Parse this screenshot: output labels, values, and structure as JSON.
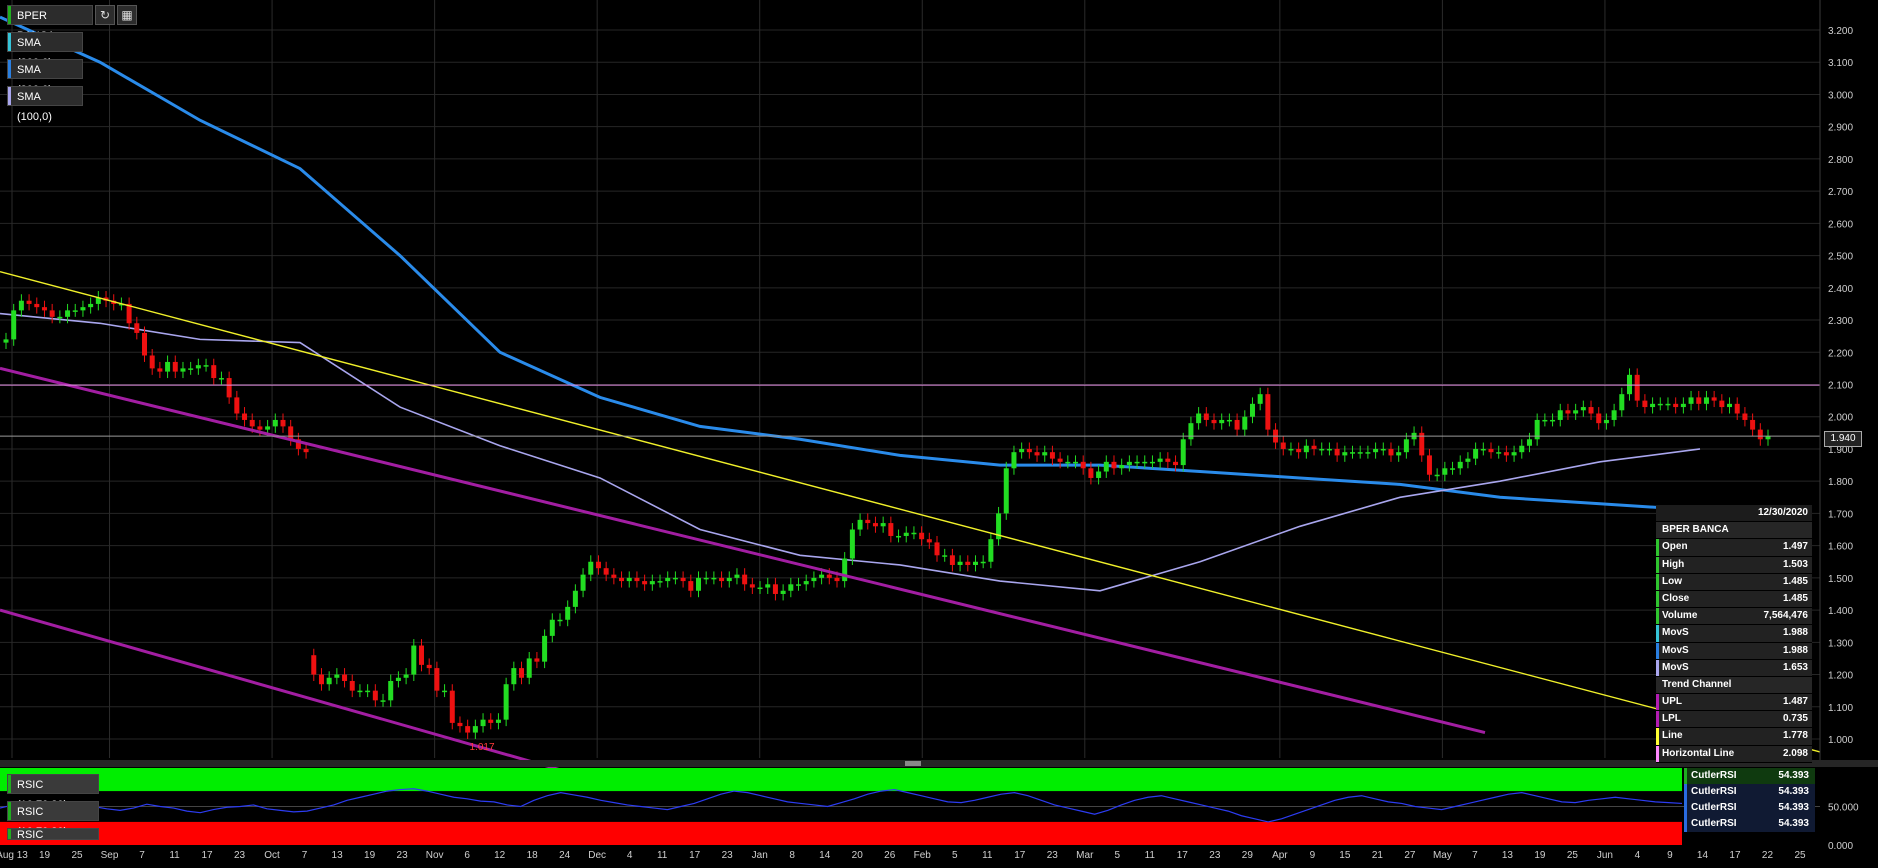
{
  "instrument": "BPER BANCA",
  "toolbar": {
    "refresh_icon": "refresh-icon",
    "calendar_icon": "calendar-icon"
  },
  "indicators": [
    {
      "label": "SMA (200,0)",
      "color": "#35c4d8"
    },
    {
      "label": "SMA (200,0)",
      "color": "#2a7fe0"
    },
    {
      "label": "SMA (100,0)",
      "color": "#a9a6ee"
    }
  ],
  "last_price": "1.940",
  "chart_data": {
    "type": "candlestick",
    "title": "BPER BANCA",
    "ylim": [
      0.9,
      3.25
    ],
    "yticks": [
      "1.000",
      "1.100",
      "1.200",
      "1.300",
      "1.400",
      "1.500",
      "1.600",
      "1.700",
      "1.800",
      "1.900",
      "2.000",
      "2.100",
      "2.200",
      "2.300",
      "2.400",
      "2.500",
      "2.600",
      "2.700",
      "2.800",
      "2.900",
      "3.000",
      "3.100",
      "3.200"
    ],
    "x_tick_labels": [
      "Aug 13",
      "19",
      "25",
      "Sep",
      "7",
      "11",
      "17",
      "23",
      "Oct",
      "7",
      "13",
      "19",
      "23",
      "Nov",
      "6",
      "12",
      "18",
      "24",
      "Dec",
      "4",
      "11",
      "17",
      "23",
      "Jan",
      "8",
      "14",
      "20",
      "26",
      "Feb",
      "5",
      "11",
      "17",
      "23",
      "Mar",
      "5",
      "11",
      "17",
      "23",
      "29",
      "Apr",
      "9",
      "15",
      "21",
      "27",
      "May",
      "7",
      "13",
      "19",
      "25",
      "Jun",
      "4",
      "9",
      "14",
      "17",
      "22",
      "25"
    ],
    "close": [
      2.24,
      2.33,
      2.36,
      2.35,
      2.34,
      2.33,
      2.31,
      2.31,
      2.33,
      2.33,
      2.34,
      2.35,
      2.37,
      2.36,
      2.35,
      2.35,
      2.29,
      2.26,
      2.19,
      2.15,
      2.14,
      2.17,
      2.14,
      2.15,
      2.15,
      2.16,
      2.16,
      2.12,
      2.12,
      2.06,
      2.01,
      1.99,
      1.97,
      1.96,
      1.97,
      1.99,
      1.97,
      1.93,
      1.9,
      1.89,
      1.2,
      1.17,
      1.19,
      1.2,
      1.18,
      1.15,
      1.15,
      1.15,
      1.12,
      1.12,
      1.18,
      1.19,
      1.2,
      1.29,
      1.23,
      1.22,
      1.15,
      1.15,
      1.05,
      1.04,
      1.02,
      1.04,
      1.06,
      1.05,
      1.06,
      1.17,
      1.22,
      1.19,
      1.25,
      1.24,
      1.32,
      1.37,
      1.37,
      1.41,
      1.46,
      1.51,
      1.55,
      1.53,
      1.51,
      1.5,
      1.49,
      1.5,
      1.49,
      1.48,
      1.49,
      1.49,
      1.5,
      1.5,
      1.49,
      1.46,
      1.5,
      1.5,
      1.5,
      1.49,
      1.5,
      1.51,
      1.48,
      1.47,
      1.47,
      1.48,
      1.45,
      1.46,
      1.48,
      1.48,
      1.49,
      1.5,
      1.51,
      1.5,
      1.49,
      1.56,
      1.65,
      1.68,
      1.67,
      1.66,
      1.67,
      1.63,
      1.63,
      1.64,
      1.64,
      1.62,
      1.61,
      1.57,
      1.57,
      1.54,
      1.55,
      1.54,
      1.55,
      1.55,
      1.62,
      1.7,
      1.84,
      1.89,
      1.9,
      1.89,
      1.88,
      1.89,
      1.87,
      1.86,
      1.86,
      1.86,
      1.84,
      1.81,
      1.83,
      1.86,
      1.84,
      1.85,
      1.86,
      1.86,
      1.86,
      1.86,
      1.87,
      1.86,
      1.85,
      1.93,
      1.98,
      2.01,
      1.99,
      1.98,
      1.99,
      1.99,
      1.96,
      2.0,
      2.04,
      2.07,
      1.96,
      1.92,
      1.9,
      1.9,
      1.89,
      1.91,
      1.9,
      1.9,
      1.9,
      1.88,
      1.89,
      1.89,
      1.89,
      1.89,
      1.9,
      1.9,
      1.88,
      1.89,
      1.93,
      1.95,
      1.88,
      1.82,
      1.82,
      1.84,
      1.84,
      1.86,
      1.87,
      1.9,
      1.9,
      1.89,
      1.89,
      1.88,
      1.89,
      1.91,
      1.93,
      1.99,
      1.99,
      1.99,
      2.02,
      2.01,
      2.02,
      2.03,
      2.01,
      1.98,
      1.99,
      2.02,
      2.07,
      2.13,
      2.05,
      2.03,
      2.04,
      2.04,
      2.04,
      2.03,
      2.04,
      2.06,
      2.04,
      2.06,
      2.05,
      2.03,
      2.04,
      2.01,
      1.99,
      1.96,
      1.93,
      1.94
    ],
    "open": [
      2.23,
      2.24,
      2.33,
      2.36,
      2.35,
      2.34,
      2.33,
      2.31,
      2.31,
      2.33,
      2.33,
      2.34,
      2.35,
      2.37,
      2.36,
      2.35,
      2.35,
      2.29,
      2.26,
      2.19,
      2.15,
      2.14,
      2.17,
      2.14,
      2.15,
      2.15,
      2.16,
      2.16,
      2.12,
      2.12,
      2.06,
      2.01,
      1.99,
      1.97,
      1.96,
      1.97,
      1.99,
      1.97,
      1.93,
      1.9,
      1.26,
      1.2,
      1.17,
      1.19,
      1.2,
      1.18,
      1.15,
      1.15,
      1.15,
      1.12,
      1.12,
      1.18,
      1.19,
      1.2,
      1.29,
      1.23,
      1.22,
      1.15,
      1.15,
      1.05,
      1.04,
      1.02,
      1.04,
      1.06,
      1.05,
      1.06,
      1.17,
      1.22,
      1.19,
      1.25,
      1.24,
      1.32,
      1.37,
      1.37,
      1.41,
      1.46,
      1.51,
      1.55,
      1.53,
      1.51,
      1.5,
      1.49,
      1.5,
      1.49,
      1.48,
      1.49,
      1.49,
      1.5,
      1.5,
      1.49,
      1.46,
      1.5,
      1.5,
      1.5,
      1.49,
      1.5,
      1.51,
      1.48,
      1.47,
      1.47,
      1.48,
      1.45,
      1.46,
      1.48,
      1.48,
      1.49,
      1.5,
      1.51,
      1.5,
      1.49,
      1.56,
      1.65,
      1.68,
      1.67,
      1.66,
      1.67,
      1.63,
      1.63,
      1.64,
      1.64,
      1.62,
      1.61,
      1.57,
      1.57,
      1.54,
      1.55,
      1.54,
      1.55,
      1.55,
      1.62,
      1.7,
      1.84,
      1.89,
      1.9,
      1.89,
      1.88,
      1.89,
      1.87,
      1.86,
      1.86,
      1.86,
      1.84,
      1.81,
      1.83,
      1.86,
      1.84,
      1.85,
      1.86,
      1.86,
      1.86,
      1.86,
      1.87,
      1.86,
      1.85,
      1.93,
      1.98,
      2.01,
      1.99,
      1.98,
      1.99,
      1.99,
      1.96,
      2.0,
      2.04,
      2.07,
      1.96,
      1.92,
      1.9,
      1.9,
      1.89,
      1.91,
      1.9,
      1.9,
      1.9,
      1.88,
      1.89,
      1.89,
      1.89,
      1.89,
      1.9,
      1.9,
      1.88,
      1.89,
      1.93,
      1.95,
      1.88,
      1.82,
      1.82,
      1.84,
      1.84,
      1.86,
      1.87,
      1.9,
      1.9,
      1.89,
      1.89,
      1.88,
      1.89,
      1.91,
      1.93,
      1.99,
      1.99,
      1.99,
      2.02,
      2.01,
      2.02,
      2.03,
      2.01,
      1.98,
      1.99,
      2.02,
      2.07,
      2.13,
      2.05,
      2.03,
      2.04,
      2.04,
      2.04,
      2.03,
      2.04,
      2.06,
      2.04,
      2.06,
      2.05,
      2.03,
      2.04,
      2.01,
      1.99,
      1.96,
      1.93
    ],
    "low_label": "1.017",
    "sma_long": [
      [
        0,
        3.24
      ],
      [
        100,
        3.1
      ],
      [
        200,
        2.92
      ],
      [
        300,
        2.77
      ],
      [
        400,
        2.5
      ],
      [
        500,
        2.2
      ],
      [
        600,
        2.06
      ],
      [
        700,
        1.97
      ],
      [
        800,
        1.93
      ],
      [
        900,
        1.88
      ],
      [
        1000,
        1.85
      ],
      [
        1100,
        1.85
      ],
      [
        1200,
        1.83
      ],
      [
        1300,
        1.81
      ],
      [
        1400,
        1.79
      ],
      [
        1500,
        1.75
      ],
      [
        1600,
        1.73
      ],
      [
        1700,
        1.71
      ]
    ],
    "sma_100": [
      [
        0,
        2.32
      ],
      [
        100,
        2.29
      ],
      [
        200,
        2.24
      ],
      [
        300,
        2.23
      ],
      [
        400,
        2.03
      ],
      [
        500,
        1.91
      ],
      [
        600,
        1.81
      ],
      [
        700,
        1.65
      ],
      [
        800,
        1.57
      ],
      [
        900,
        1.54
      ],
      [
        1000,
        1.49
      ],
      [
        1100,
        1.46
      ],
      [
        1200,
        1.55
      ],
      [
        1300,
        1.66
      ],
      [
        1400,
        1.75
      ],
      [
        1500,
        1.8
      ],
      [
        1600,
        1.86
      ],
      [
        1700,
        1.9
      ]
    ],
    "trend_line": {
      "start": 2.45,
      "end": 0.96
    },
    "channel_upper": {
      "start": 2.15,
      "end": 1.02
    },
    "channel_lower": {
      "start": 1.4,
      "end": 0.57
    },
    "horizontal_line": 2.098,
    "last_price_line": 1.94
  },
  "info_panel": {
    "date": "12/30/2020",
    "name": "BPER BANCA",
    "rows": [
      {
        "label": "Open",
        "value": "1.497",
        "color": "#2fc52f"
      },
      {
        "label": "High",
        "value": "1.503",
        "color": "#2fc52f"
      },
      {
        "label": "Low",
        "value": "1.485",
        "color": "#2fc52f"
      },
      {
        "label": "Close",
        "value": "1.485",
        "color": "#2fc52f"
      },
      {
        "label": "Volume",
        "value": "7,564,476",
        "color": "#2fc52f"
      },
      {
        "label": "MovS",
        "value": "1.988",
        "color": "#35c4d8"
      },
      {
        "label": "MovS",
        "value": "1.988",
        "color": "#2a7fe0"
      },
      {
        "label": "MovS",
        "value": "1.653",
        "color": "#a9a6ee"
      }
    ],
    "section": "Trend Channel",
    "rows2": [
      {
        "label": "UPL",
        "value": "1.487",
        "color": "#b31cb3"
      },
      {
        "label": "LPL",
        "value": "0.735",
        "color": "#b31cb3"
      },
      {
        "label": "Line",
        "value": "1.778",
        "color": "#ffff33"
      },
      {
        "label": "Horizontal Line",
        "value": "2.098",
        "color": "#ff88ff"
      }
    ]
  },
  "rsi": {
    "labels": [
      "RSIC (10,70,30)",
      "RSIC (10,70,30)",
      "RSIC (10,70,30)"
    ],
    "boxes": [
      {
        "label": "CutlerRSI",
        "value": "54.393",
        "color": "#1fae1f"
      },
      {
        "label": "CutlerRSI",
        "value": "54.393",
        "color": "#2a6be0"
      },
      {
        "label": "CutlerRSI",
        "value": "54.393",
        "color": "#2a6be0"
      },
      {
        "label": "CutlerRSI",
        "value": "54.393",
        "color": "#2a6be0"
      }
    ],
    "yticks": [
      "0.000",
      "50.000"
    ],
    "rsi_values": [
      48,
      52,
      50,
      46,
      44,
      49,
      52,
      50,
      47,
      45,
      48,
      53,
      50,
      48,
      44,
      42,
      46,
      49,
      50,
      52,
      47,
      45,
      43,
      44,
      48,
      52,
      58,
      62,
      66,
      70,
      72,
      73,
      70,
      66,
      62,
      60,
      57,
      56,
      52,
      50,
      58,
      64,
      68,
      65,
      62,
      58,
      55,
      52,
      50,
      48,
      46,
      50,
      54,
      60,
      66,
      70,
      68,
      64,
      60,
      56,
      54,
      52,
      50,
      55,
      60,
      66,
      70,
      72,
      68,
      64,
      60,
      56,
      55,
      58,
      62,
      66,
      68,
      64,
      58,
      52,
      48,
      44,
      40,
      45,
      52,
      58,
      62,
      64,
      60,
      56,
      52,
      48,
      44,
      38,
      34,
      30,
      34,
      40,
      46,
      52,
      58,
      62,
      64,
      60,
      56,
      54,
      50,
      48,
      46,
      50,
      54,
      58,
      62,
      66,
      68,
      64,
      60,
      56,
      55,
      58,
      60,
      62,
      60,
      58,
      56,
      55,
      54
    ]
  }
}
